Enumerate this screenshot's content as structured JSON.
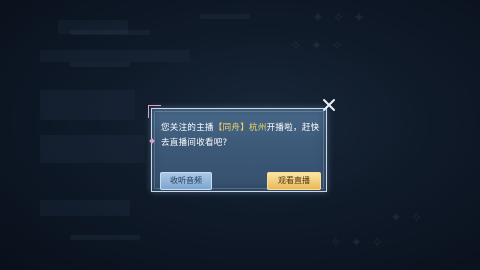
{
  "dialog": {
    "message_prefix": "您关注的主播",
    "anchor_tag": "【同舟】",
    "anchor_location": "杭州",
    "message_suffix": "开播啦，赶快去直播间收看吧?",
    "listen_button_label": "收听音频",
    "watch_button_label": "观看直播"
  },
  "colors": {
    "highlight": "#f2d66b",
    "watch_button": "#eab75a",
    "listen_button": "#7fa6cf"
  }
}
